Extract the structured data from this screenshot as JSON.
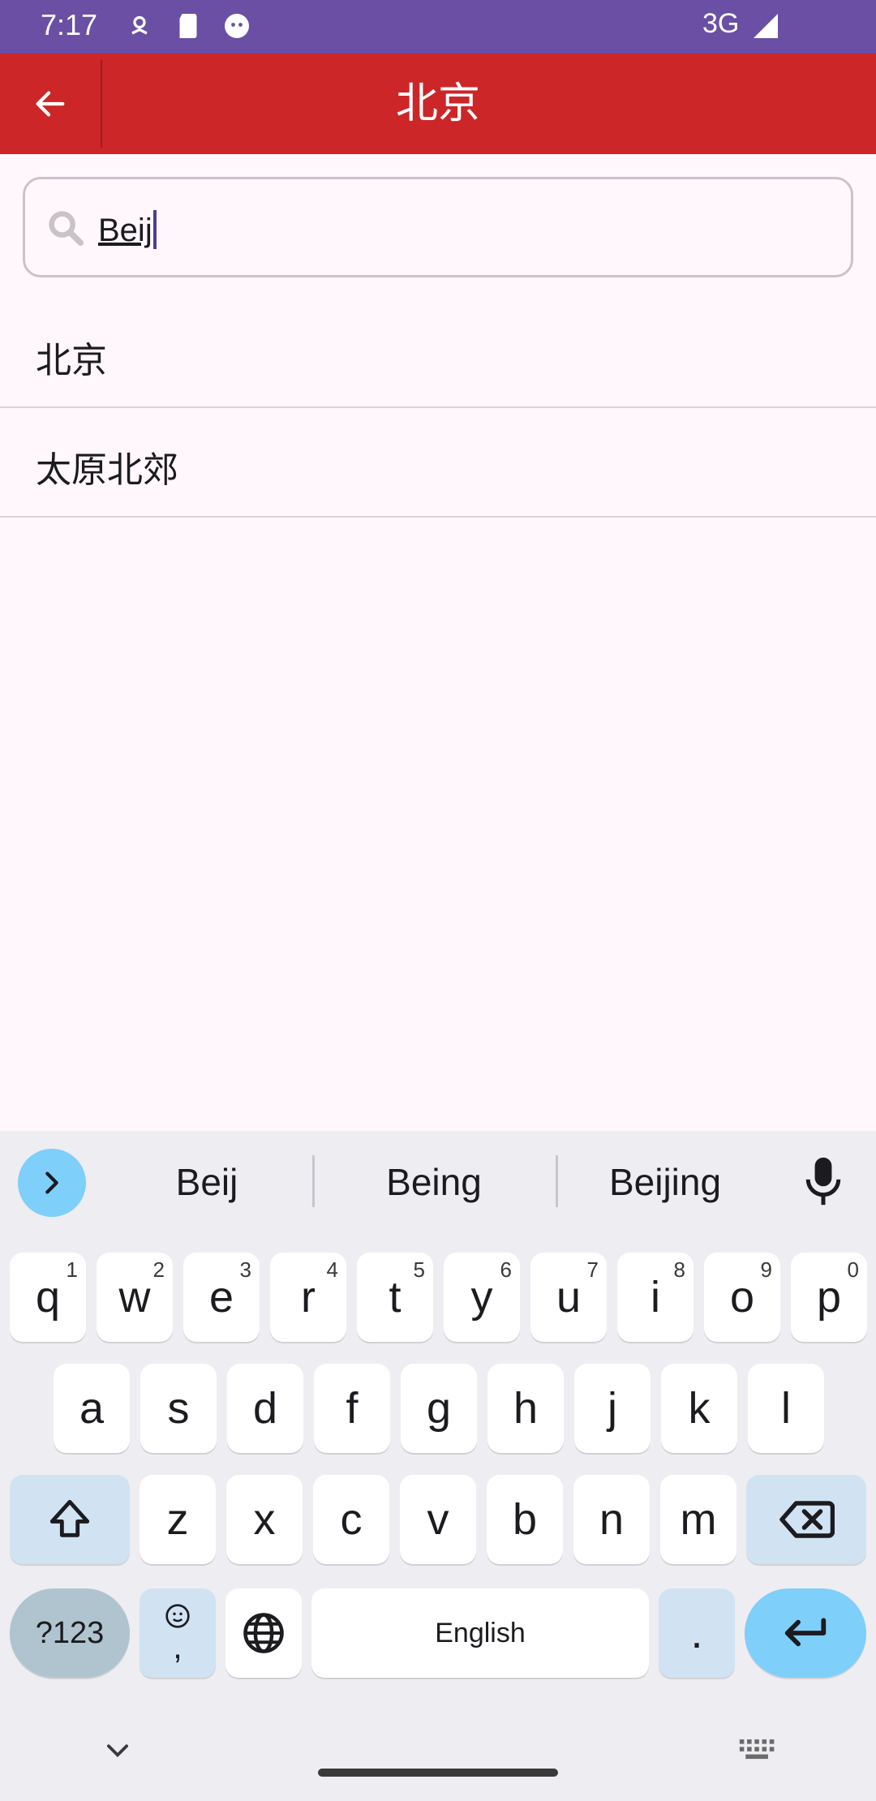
{
  "status_bar": {
    "time": "7:17",
    "network": "3G"
  },
  "app_bar": {
    "title": "北京"
  },
  "search": {
    "value": "Beij"
  },
  "results": [
    {
      "label": "北京"
    },
    {
      "label": "太原北郊"
    }
  ],
  "keyboard": {
    "suggestions": [
      "Beij",
      "Being",
      "Beijing"
    ],
    "row1": [
      {
        "k": "q",
        "h": "1"
      },
      {
        "k": "w",
        "h": "2"
      },
      {
        "k": "e",
        "h": "3"
      },
      {
        "k": "r",
        "h": "4"
      },
      {
        "k": "t",
        "h": "5"
      },
      {
        "k": "y",
        "h": "6"
      },
      {
        "k": "u",
        "h": "7"
      },
      {
        "k": "i",
        "h": "8"
      },
      {
        "k": "o",
        "h": "9"
      },
      {
        "k": "p",
        "h": "0"
      }
    ],
    "row2": [
      "a",
      "s",
      "d",
      "f",
      "g",
      "h",
      "j",
      "k",
      "l"
    ],
    "row3": [
      "z",
      "x",
      "c",
      "v",
      "b",
      "n",
      "m"
    ],
    "symbols_label": "?123",
    "emoji_comma_label": ",",
    "space_label": "English",
    "period_label": "."
  },
  "colors": {
    "status_bar": "#6a4fa4",
    "app_bar": "#cc2629",
    "accent_key": "#7ecff9"
  }
}
